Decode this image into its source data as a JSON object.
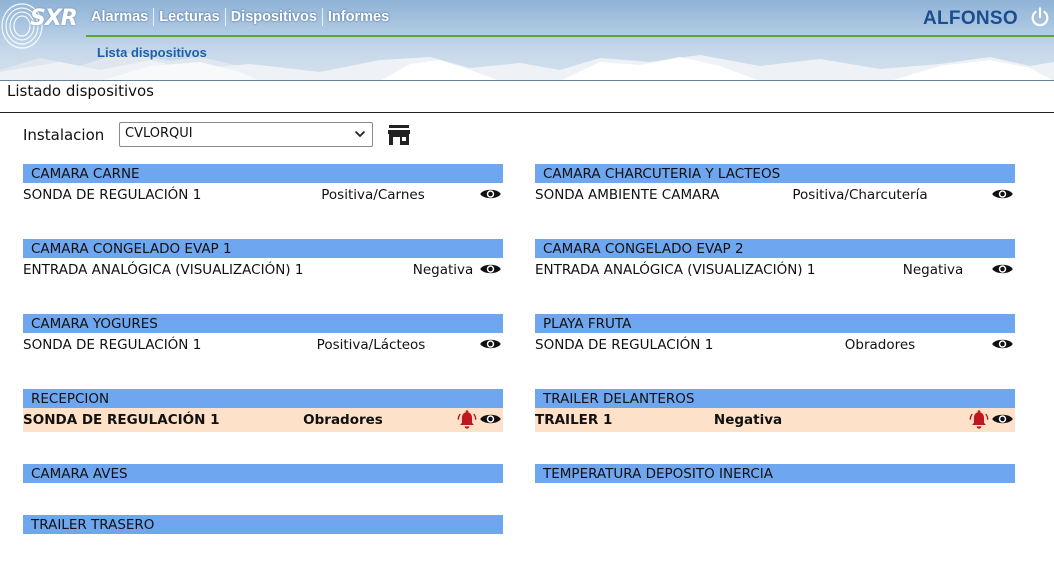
{
  "header": {
    "logo_text": "SXR",
    "nav": [
      "Alarmas",
      "Lecturas",
      "Dispositivos",
      "Informes"
    ],
    "subnav": "Lista dispositivos",
    "user": "ALFONSO"
  },
  "page": {
    "title": "Listado dispositivos",
    "installation_label": "Instalacion",
    "installation_value": "CVLORQUI"
  },
  "groups": [
    {
      "name": "CAMARA CARNE",
      "devices": [
        {
          "name": "SONDA DE REGULACIÓN 1",
          "type": "Positiva/Carnes",
          "alarm": false
        }
      ]
    },
    {
      "name": "CAMARA CHARCUTERIA Y LACTEOS",
      "devices": [
        {
          "name": "SONDA AMBIENTE CAMARA",
          "type": "Positiva/Charcutería",
          "alarm": false
        }
      ]
    },
    {
      "name": "CAMARA CONGELADO EVAP 1",
      "devices": [
        {
          "name": "ENTRADA ANALÓGICA (VISUALIZACIÓN) 1",
          "type": "Negativa",
          "alarm": false
        }
      ]
    },
    {
      "name": "CAMARA CONGELADO EVAP 2",
      "devices": [
        {
          "name": "ENTRADA ANALÓGICA (VISUALIZACIÓN) 1",
          "type": "Negativa",
          "alarm": false
        }
      ]
    },
    {
      "name": "CAMARA YOGURES",
      "devices": [
        {
          "name": "SONDA DE REGULACIÓN 1",
          "type": "Positiva/Lácteos",
          "alarm": false
        }
      ]
    },
    {
      "name": "PLAYA FRUTA",
      "devices": [
        {
          "name": "SONDA DE REGULACIÓN 1",
          "type": "Obradores",
          "alarm": false
        }
      ]
    },
    {
      "name": "RECEPCION",
      "devices": [
        {
          "name": "SONDA DE REGULACIÓN 1",
          "type": "Obradores",
          "alarm": true
        }
      ]
    },
    {
      "name": "TRAILER DELANTEROS",
      "devices": [
        {
          "name": "TRAILER 1",
          "type": "Negativa",
          "alarm": true
        }
      ]
    },
    {
      "name": "CAMARA AVES",
      "devices": []
    },
    {
      "name": "TEMPERATURA DEPOSITO INERCIA",
      "devices": []
    },
    {
      "name": "TRAILER TRASERO",
      "devices": []
    }
  ],
  "colors": {
    "group_header": "#6ea6ef",
    "alarm_row": "#fde1c9",
    "alarm_bell": "#c0171c",
    "accent_green": "#5aa832",
    "user_blue": "#1b4d91"
  }
}
